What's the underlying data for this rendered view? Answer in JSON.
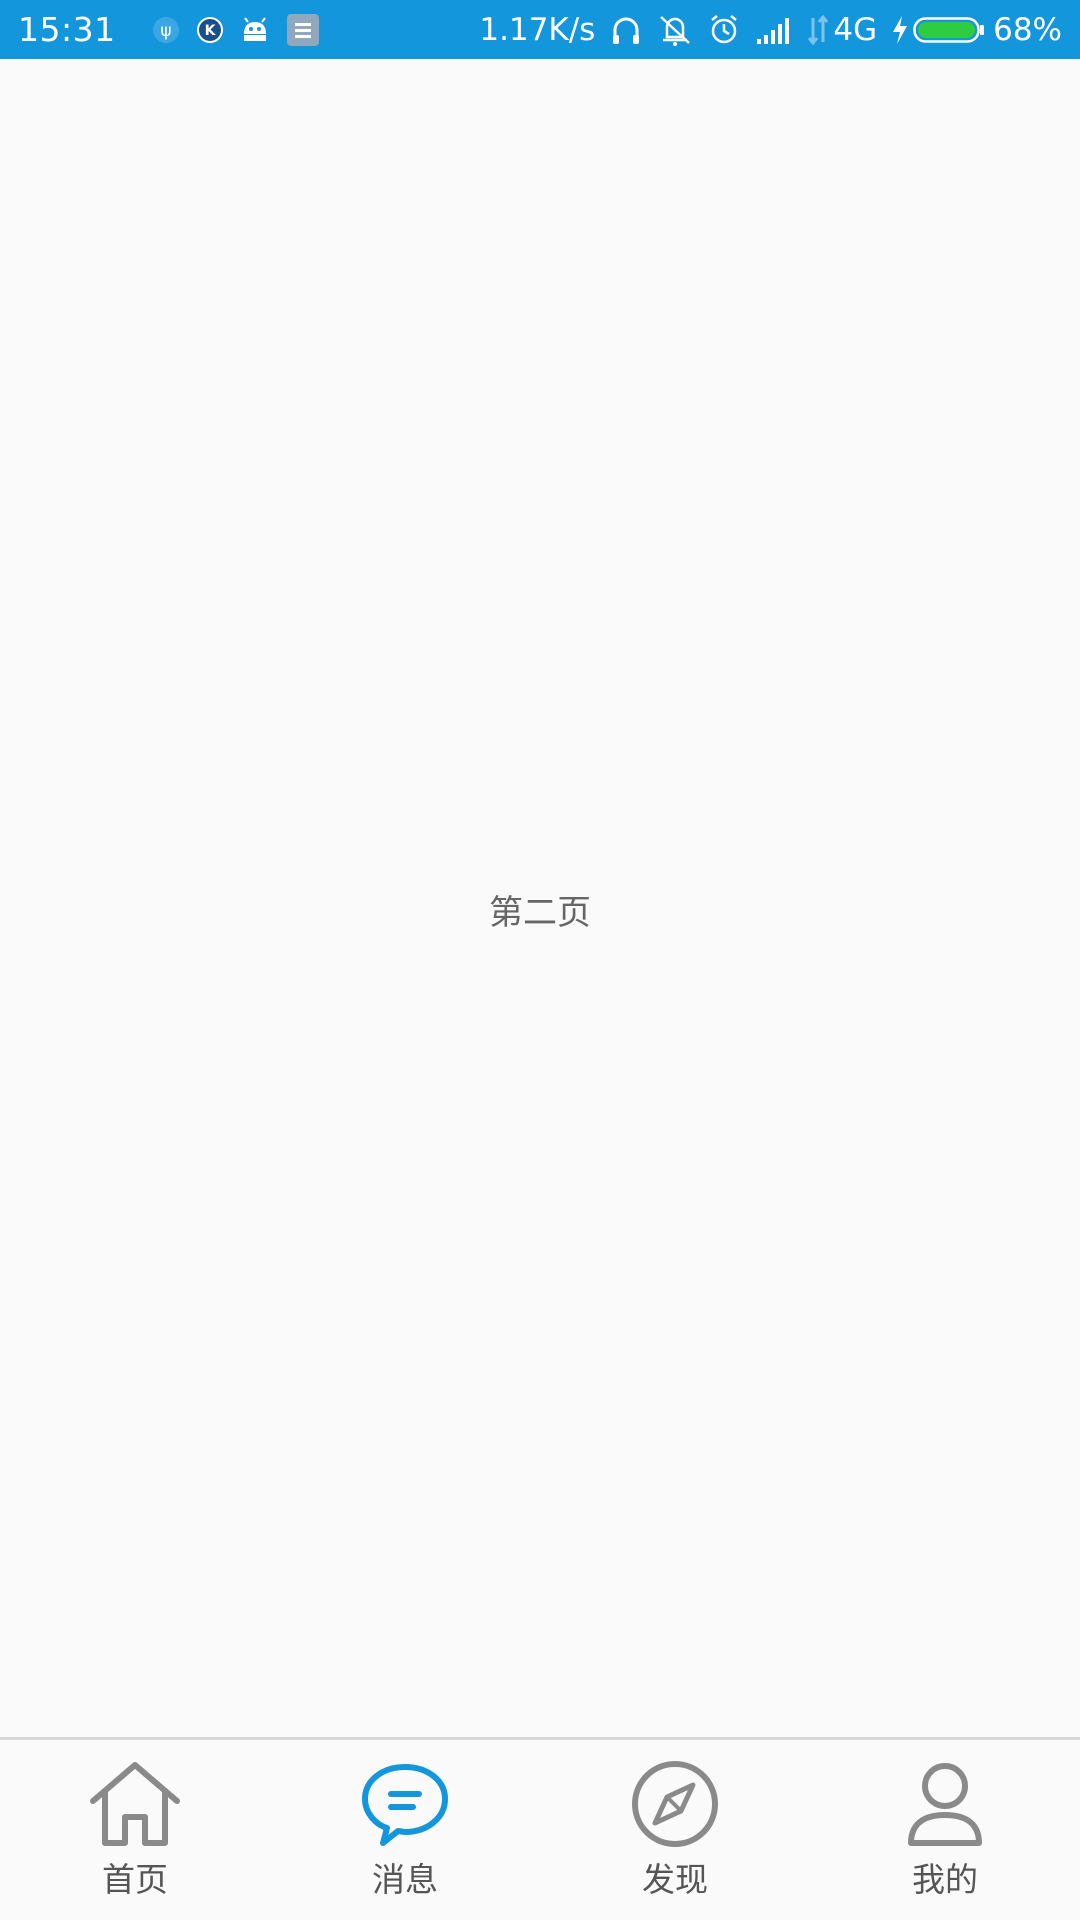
{
  "status_bar": {
    "time": "15:31",
    "net_speed": "1.17K/s",
    "network_type": "4G",
    "battery_percent": "68%",
    "battery_level": 0.68,
    "colors": {
      "background": "#1496dc",
      "battery_fill": "#2ecc40"
    },
    "left_icons": [
      "usb-icon",
      "k-app-icon",
      "android-icon",
      "notification-app-icon"
    ],
    "right_icons": [
      "headphones-icon",
      "vibrate-off-icon",
      "alarm-icon",
      "signal-icon",
      "data-arrows-icon",
      "charging-icon",
      "battery-icon"
    ]
  },
  "content": {
    "page_label": "第二页"
  },
  "tab_bar": {
    "active_color": "#1496dc",
    "inactive_color": "#8a8a8a",
    "tabs": [
      {
        "label": "首页",
        "icon": "home-icon",
        "active": false
      },
      {
        "label": "消息",
        "icon": "message-icon",
        "active": true
      },
      {
        "label": "发现",
        "icon": "compass-icon",
        "active": false
      },
      {
        "label": "我的",
        "icon": "profile-icon",
        "active": false
      }
    ]
  }
}
